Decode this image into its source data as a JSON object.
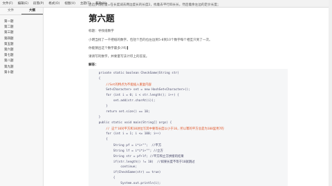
{
  "menubar": {
    "items": [
      "文件(F)",
      "编辑(E)",
      "段落(P)",
      "格式(O)",
      "视图(V)",
      "主题(T)",
      "帮助(H)"
    ]
  },
  "sidebar": {
    "tabs": [
      "文件",
      "大纲"
    ],
    "active_tab": "大纲",
    "toc": [
      "第一题",
      "第二题",
      "第三题",
      "第四题",
      "第五题",
      "第六题",
      "第七题",
      "第八题",
      "第九题",
      "第十题"
    ]
  },
  "doc": {
    "top_line": "启迈步伐慰量=在长度减去两边度长的长度2，找着去平行四长长，然后着余左边的定价长度；",
    "heading": "第六题",
    "label": "标题：寻找纸数字",
    "para1": "小明当找了一千把纸的数字。包括个百的位左边到5-8到10个数字每个相互只到了一次。",
    "para2": "你能猜出这个数字最多少吗",
    "para3": "请请写的数字，并要量写法计印上的答案。",
    "answer_label": "解答："
  },
  "code": {
    "lines": [
      {
        "text": "    private static boolean CheckSame(String str)",
        "kind": "normal"
      },
      {
        "text": "    {",
        "kind": "normal"
      },
      {
        "text": "        //Set的特点为不能插入重复内容",
        "kind": "comment"
      },
      {
        "text": "        Set<Character> set = new HashSet<Character>();",
        "kind": "normal"
      },
      {
        "text": "        for (int i = 0; i < str.length(); i++) {",
        "kind": "normal"
      },
      {
        "text": "            set.add(str.charAt(i));",
        "kind": "normal"
      },
      {
        "text": "        }",
        "kind": "normal"
      },
      {
        "text": "        return set.size() == 10;",
        "kind": "normal"
      },
      {
        "text": "    }",
        "kind": "normal"
      },
      {
        "text": "    public static void main(String[] args) {",
        "kind": "normal"
      },
      {
        "text": "        // 这个10对平方和10进位写其中要等长度以小于10，所以幂的平方总是为100里用7的",
        "kind": "comment"
      },
      {
        "text": "        for (int i = 1; i <= 100; i++)",
        "kind": "normal"
      },
      {
        "text": "        {",
        "kind": "normal"
      },
      {
        "text": "            String pf = i*i+\"\";  //平方",
        "kind": "normal"
      },
      {
        "text": "            String lf = i*i*i+\"\"; //立方",
        "kind": "normal"
      },
      {
        "text": "            String str = pf+lf; //平方和立方拼接的结果",
        "kind": "normal"
      },
      {
        "text": "            if(str.length() != 10)  //如果长度不等于10就跳过",
        "kind": "normal"
      },
      {
        "text": "                continue;",
        "kind": "normal"
      },
      {
        "text": "            if(CheckSame(str) == true)",
        "kind": "normal"
      },
      {
        "text": "            {",
        "kind": "normal"
      },
      {
        "text": "                System.out.println(i);",
        "kind": "normal"
      }
    ]
  }
}
